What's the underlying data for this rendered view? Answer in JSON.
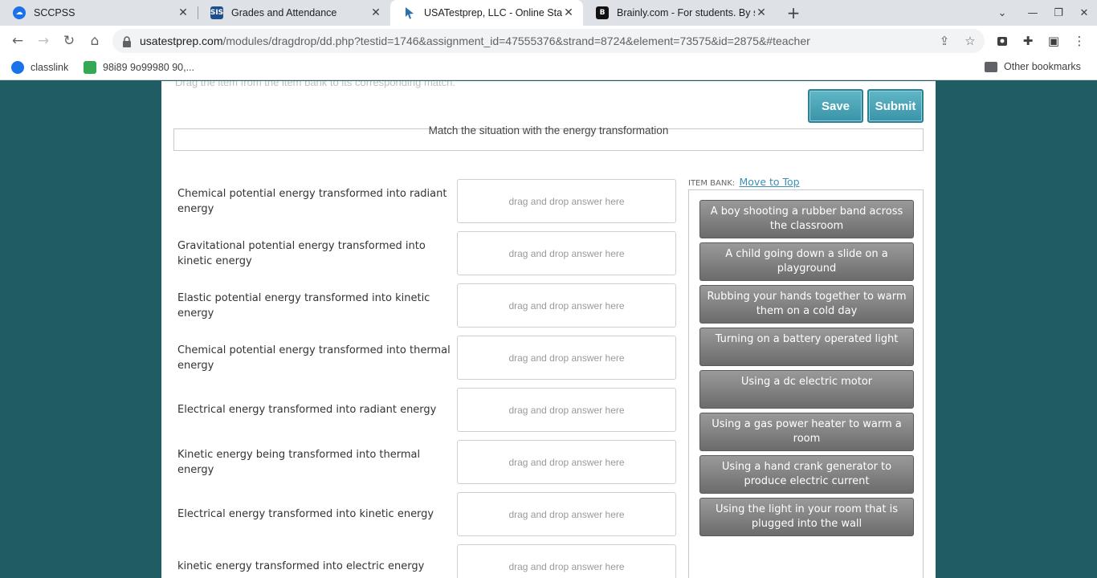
{
  "browser": {
    "tabs": [
      {
        "title": "SCCPSS",
        "favicon": "classlink-cloud-icon",
        "active": false
      },
      {
        "title": "Grades and Attendance",
        "favicon": "sis-icon",
        "active": false
      },
      {
        "title": "USATestprep, LLC - Online State-S",
        "favicon": "usatestprep-cursor-icon",
        "active": true
      },
      {
        "title": "Brainly.com - For students. By st",
        "favicon": "brainly-icon",
        "active": false
      }
    ],
    "url_host": "usatestprep.com",
    "url_path": "/modules/dragdrop/dd.php?testid=1746&assignment_id=47555376&strand=8724&element=73575&id=2875&#teacher",
    "bookmarks": [
      {
        "label": "classlink",
        "icon": "classlink-cloud-icon"
      },
      {
        "label": "98i89  9o99980 90,...",
        "icon": "green-c-icon"
      }
    ],
    "other_bookmarks": "Other bookmarks"
  },
  "page": {
    "instructions": "Drag the item from the item bank to its corresponding match.",
    "save_label": "Save",
    "submit_label": "Submit",
    "question": "Match the situation with the energy transformation",
    "dropzone_placeholder": "drag and drop answer here",
    "prompts": [
      "Chemical potential energy transformed into radiant energy",
      "Gravitational potential energy transformed into kinetic energy",
      "Elastic potential energy transformed into kinetic energy",
      "Chemical potential energy transformed into thermal energy",
      "Electrical energy transformed into radiant energy",
      "Kinetic energy being transformed into thermal energy",
      "Electrical energy transformed into kinetic energy",
      "kinetic energy transformed into electric energy"
    ],
    "item_bank_label": "ITEM BANK:",
    "move_to_top": "Move to Top",
    "item_bank": [
      "A boy shooting a rubber band across the classroom",
      "A child going down a slide on a playground",
      "Rubbing your hands together to warm them on a cold day",
      "Turning on a battery operated light",
      "Using a dc electric motor",
      "Using a gas power heater to warm a room",
      "Using a hand crank generator to produce electric current",
      "Using the light in your room that is plugged into the wall"
    ]
  },
  "colors": {
    "page_background": "#1f5c63",
    "button_teal": "#3a93a8",
    "bank_item_gray": "#7a7a7a",
    "link_blue": "#3d8fb8"
  }
}
